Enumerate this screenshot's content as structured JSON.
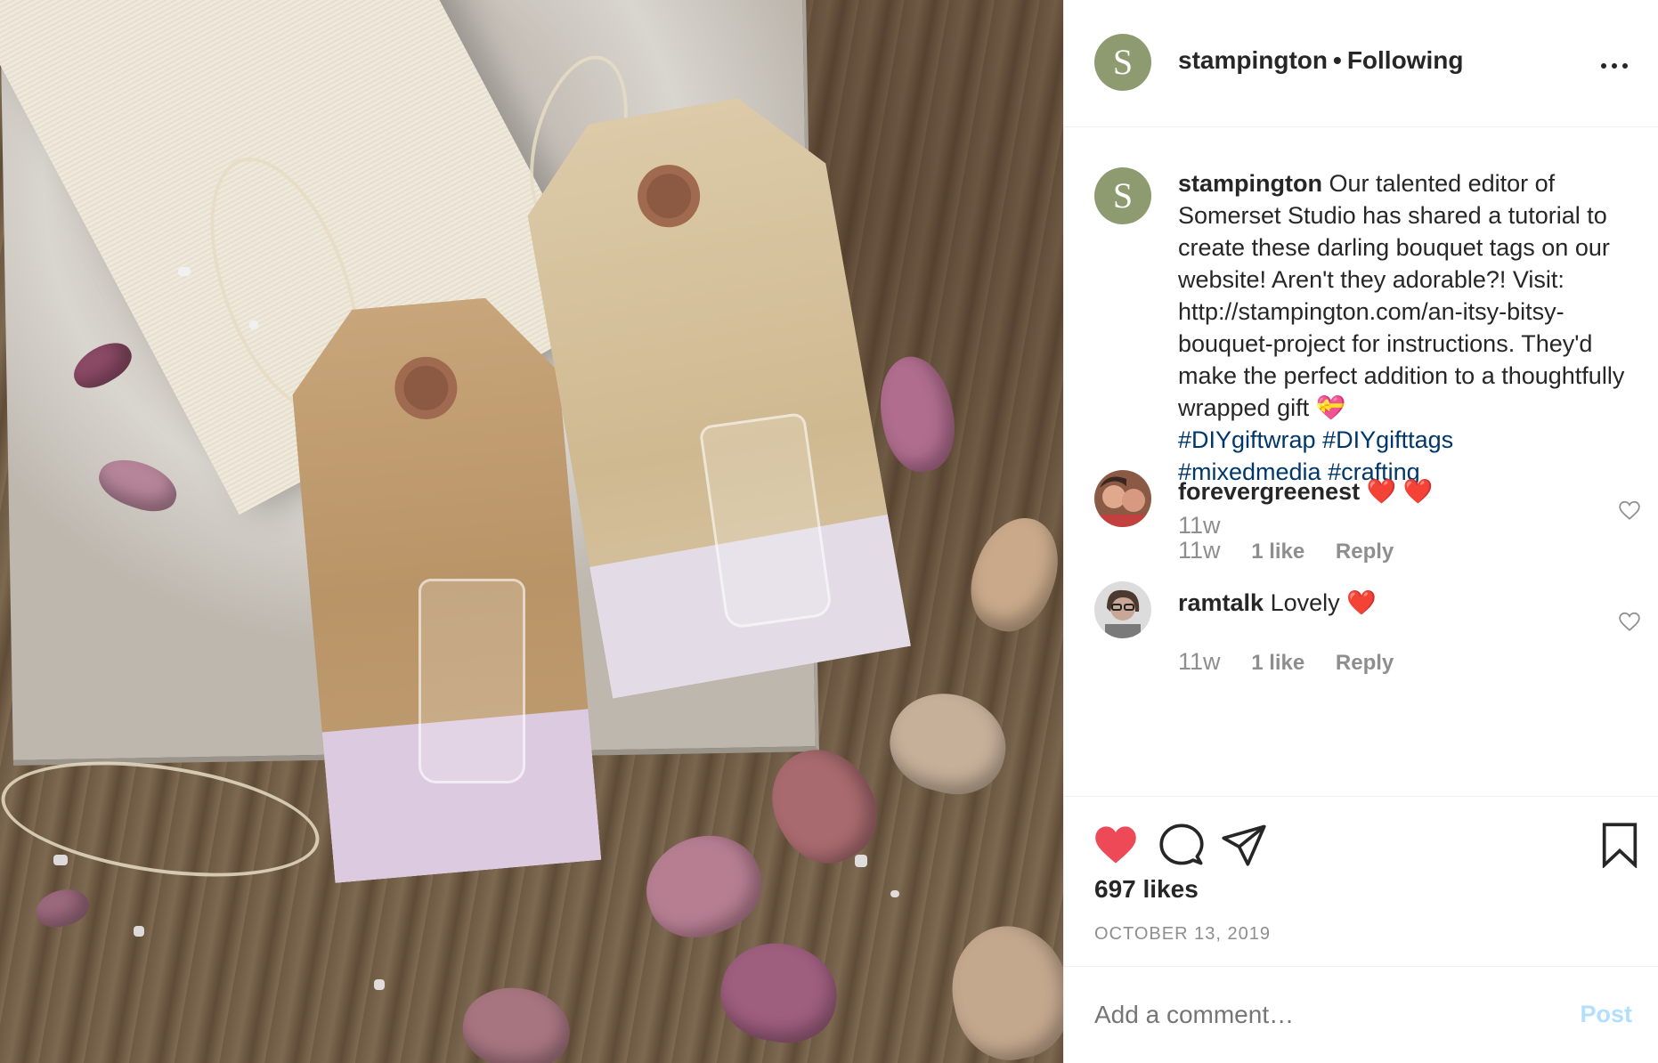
{
  "post": {
    "author": "stampington",
    "follow_sep": "•",
    "follow_status": "Following",
    "avatar_letter": "S",
    "caption": {
      "username": "stampington",
      "text": "Our talented editor of Somerset Studio has shared a tutorial to create these darling bouquet tags on our website! Aren't they adorable?! Visit: http://stampington.com/an-itsy-bitsy-bouquet-project for instructions. They'd make the perfect addition to a thoughtfully wrapped gift",
      "emoji": "💝",
      "hashtags": [
        "#DIYgiftwrap",
        "#DIYgifttags",
        "#mixedmedia",
        "#crafting"
      ],
      "time": "11w"
    },
    "comments": [
      {
        "username": "forevergreenest",
        "text": "",
        "emoji": "❤️ ❤️",
        "time": "11w",
        "likes": "1 like",
        "reply": "Reply"
      },
      {
        "username": "ramtalk",
        "text": "Lovely",
        "emoji": "❤️",
        "time": "11w",
        "likes": "1 like",
        "reply": "Reply"
      }
    ],
    "likes": "697 likes",
    "date": "OCTOBER 13, 2019",
    "add_comment_placeholder": "Add a comment…",
    "post_button": "Post",
    "icons": {
      "like": "heart-filled-icon",
      "comment": "comment-bubble-icon",
      "share": "paper-plane-icon",
      "save": "bookmark-icon",
      "more": "more-options-icon"
    },
    "colors": {
      "like_red": "#ed4956",
      "hashtag_blue": "#00376b",
      "muted": "#8e8e8e",
      "post_disabled": "#b2dffc",
      "avatar_green": "#8e9a6f"
    }
  }
}
